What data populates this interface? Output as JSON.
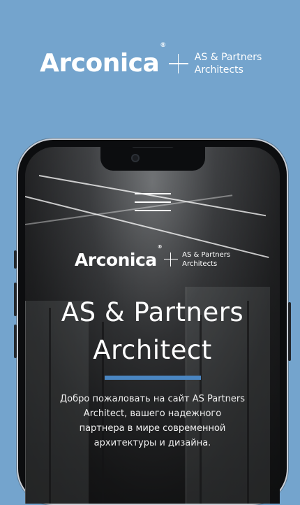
{
  "brand": {
    "name": "Arconica",
    "registered_mark": "®",
    "partner_line1": "AS & Partners",
    "partner_line2": "Architects"
  },
  "colors": {
    "background": "#74a4cd",
    "accent": "#4a86c2",
    "text": "#ffffff"
  },
  "phone_screen": {
    "menu_icon": "hamburger-menu-icon",
    "hero_title_line1": "AS & Partners",
    "hero_title_line2": "Architect",
    "intro_text": "Добро пожаловать на сайт AS Partners Architect, вашего надежного партнера в мире современной архитектуры и дизайна."
  }
}
